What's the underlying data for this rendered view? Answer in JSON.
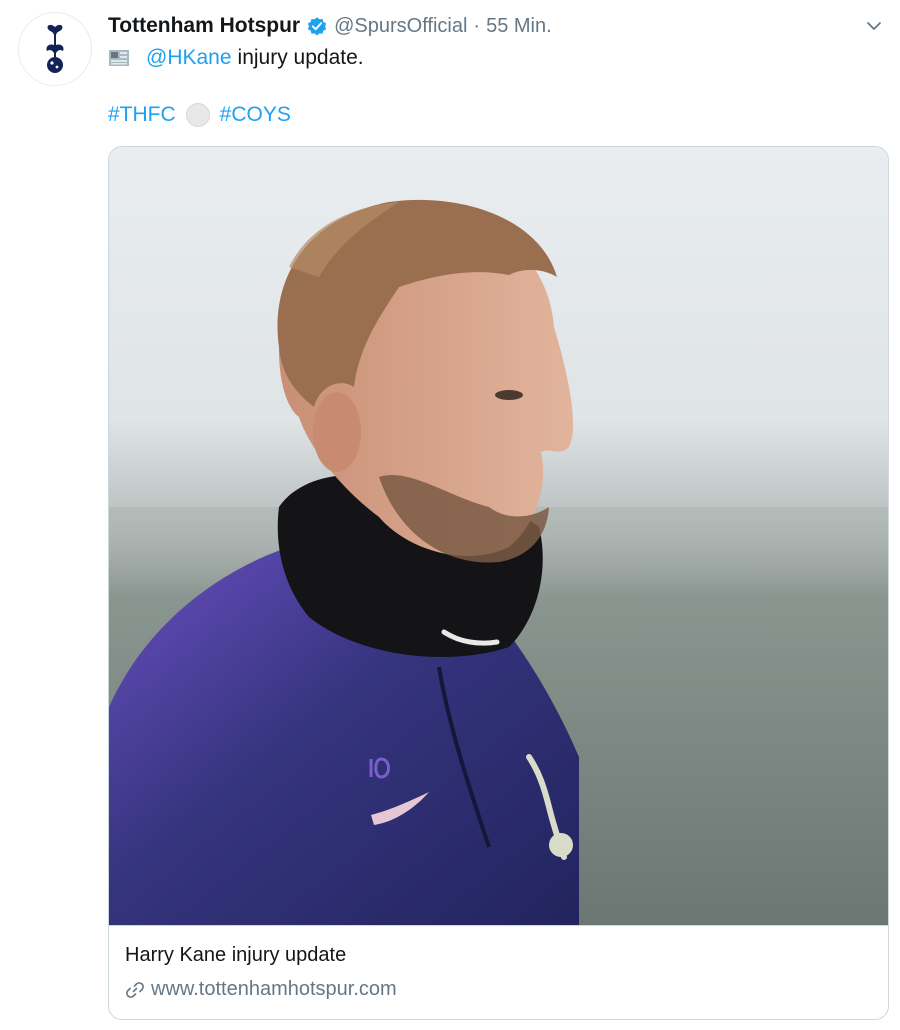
{
  "tweet": {
    "author": {
      "display_name": "Tottenham Hotspur",
      "handle": "@SpursOfficial",
      "verified": true,
      "avatar_icon": "spurs-crest-icon"
    },
    "separator": "·",
    "timestamp": "55 Min.",
    "text": {
      "emoji_1": "newspaper-emoji",
      "mention": "@HKane",
      "rest": "injury update.",
      "hashtag_1": "#THFC",
      "emoji_2": "soccer-ball-emoji",
      "hashtag_2": "#COYS"
    },
    "card": {
      "image_icon": "player-photo",
      "title": "Harry Kane injury update",
      "url": "www.tottenhamhotspur.com"
    }
  },
  "colors": {
    "link_blue": "#1da1f2",
    "secondary_text": "#657786",
    "border": "#ccd6dd",
    "kit_navy": "#2b2d7a",
    "kit_purple": "#5a3fa8"
  }
}
